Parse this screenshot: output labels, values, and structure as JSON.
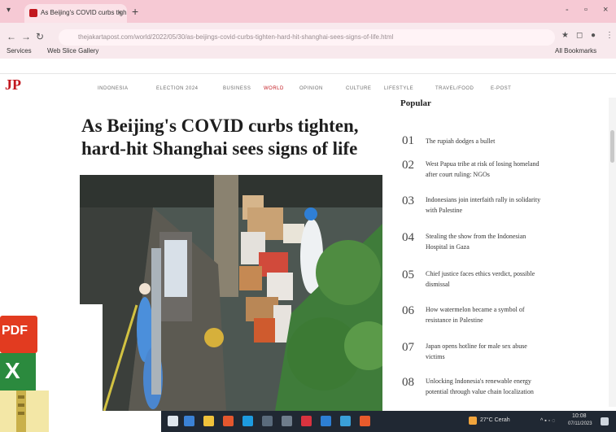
{
  "browser": {
    "tab_title": "As Beijing's COVID curbs tigh",
    "tab_close": "×",
    "new_tab": "+",
    "window_controls": [
      "-",
      "▫",
      "×"
    ],
    "address": "thejakartapost.com/world/2022/05/30/as-beijings-covid-curbs-tighten-hard-hit-shanghai-sees-signs-of-life.html",
    "bookmarks": {
      "left": [
        "Services",
        "Web Slice Gallery"
      ],
      "right": "All Bookmarks"
    }
  },
  "site": {
    "logo": "JP",
    "nav": [
      "INDONESIA",
      "ELECTION 2024",
      "BUSINESS",
      "WORLD",
      "OPINION",
      "CULTURE",
      "LIFESTYLE",
      "TRAVEL/FOOD",
      "E-POST"
    ]
  },
  "article": {
    "headline_line1": "As Beijing's COVID curbs tighten,",
    "headline_line2": "hard-hit Shanghai sees signs of life"
  },
  "popular": {
    "title": "Popular",
    "items": [
      {
        "num": "01",
        "text": "The rupiah dodges a bullet"
      },
      {
        "num": "02",
        "text": "West Papua tribe at risk of losing homeland after court ruling: NGOs"
      },
      {
        "num": "03",
        "text": "Indonesians join interfaith rally in solidarity with Palestine"
      },
      {
        "num": "04",
        "text": "Stealing the show from the Indonesian Hospital in Gaza"
      },
      {
        "num": "05",
        "text": "Chief justice faces ethics verdict, possible dismissal"
      },
      {
        "num": "06",
        "text": "How watermelon became a symbol of resistance in Palestine"
      },
      {
        "num": "07",
        "text": "Japan opens hotline for male sex abuse victims"
      },
      {
        "num": "08",
        "text": "Unlocking Indonesia's renewable energy potential through value chain localization"
      }
    ]
  },
  "desktop": {
    "pdf_label": "PDF",
    "xls_label": "X"
  },
  "taskbar": {
    "weather": "27°C Cerah",
    "time": "10:08",
    "date": "07/11/2023"
  },
  "colors": {
    "brand_red": "#c2181f",
    "tabbar_pink": "#f6c9d4",
    "taskbar": "#202833"
  }
}
